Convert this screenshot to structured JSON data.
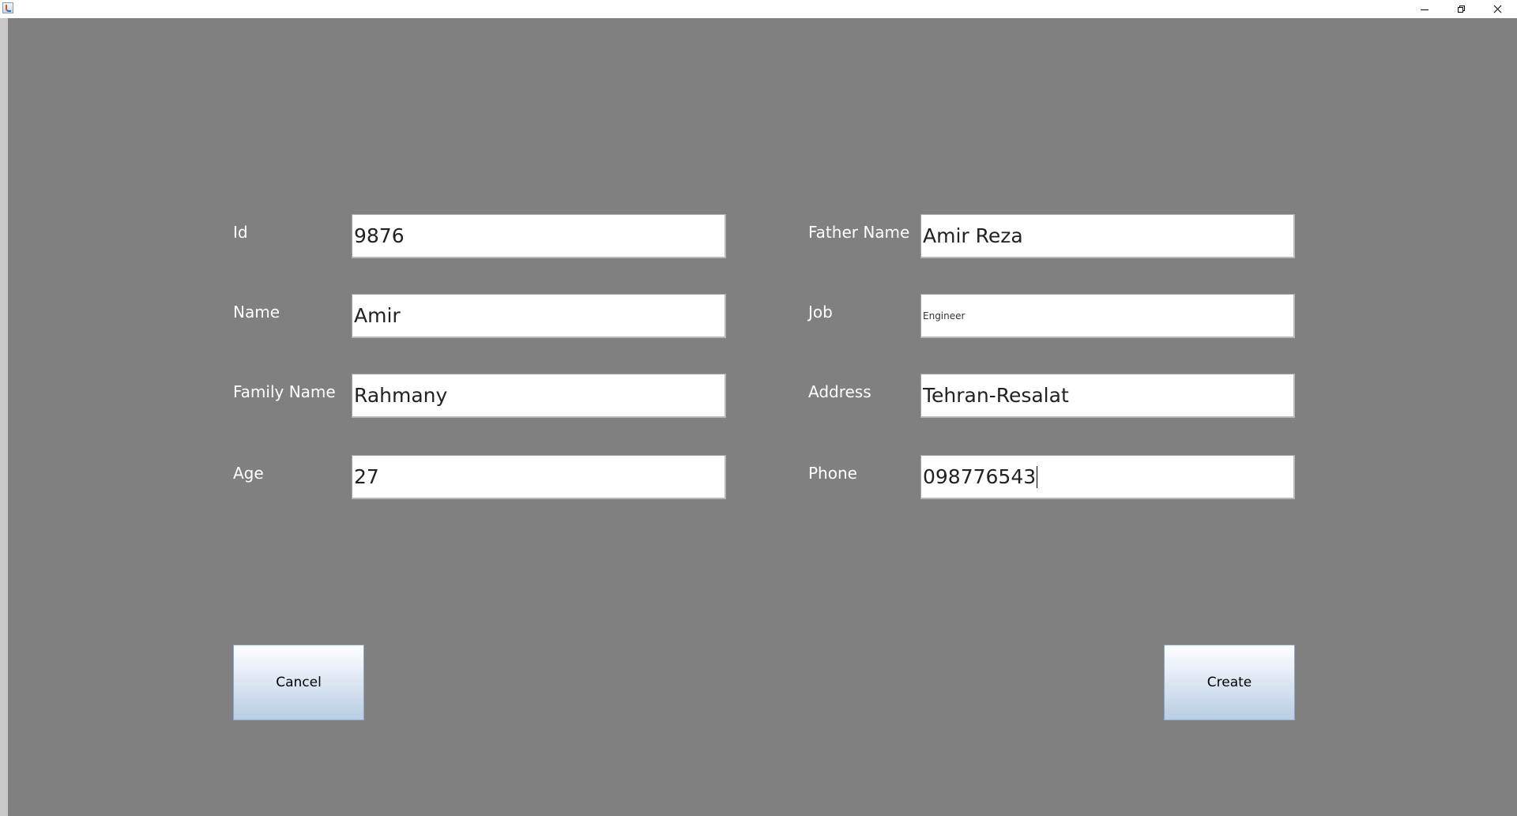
{
  "window": {
    "icon": "java-app-icon",
    "controls": {
      "minimize": "minimize-icon",
      "restore": "restore-icon",
      "close": "close-icon"
    }
  },
  "form": {
    "left": [
      {
        "key": "id",
        "label": "Id",
        "value": "9876"
      },
      {
        "key": "name",
        "label": "Name",
        "value": "Amir"
      },
      {
        "key": "family_name",
        "label": "Family Name",
        "value": "Rahmany"
      },
      {
        "key": "age",
        "label": "Age",
        "value": "27"
      }
    ],
    "right": [
      {
        "key": "father_name",
        "label": "Father Name",
        "value": "Amir Reza"
      },
      {
        "key": "job",
        "label": "Job",
        "value": "Engineer"
      },
      {
        "key": "address",
        "label": "Address",
        "value": "Tehran-Resalat"
      },
      {
        "key": "phone",
        "label": "Phone",
        "value": "098776543"
      }
    ]
  },
  "buttons": {
    "cancel": "Cancel",
    "create": "Create"
  },
  "colors": {
    "background": "#808080",
    "label_text": "#ffffff",
    "button_gradient_top": "#ffffff",
    "button_gradient_bottom": "#b9cde3"
  }
}
